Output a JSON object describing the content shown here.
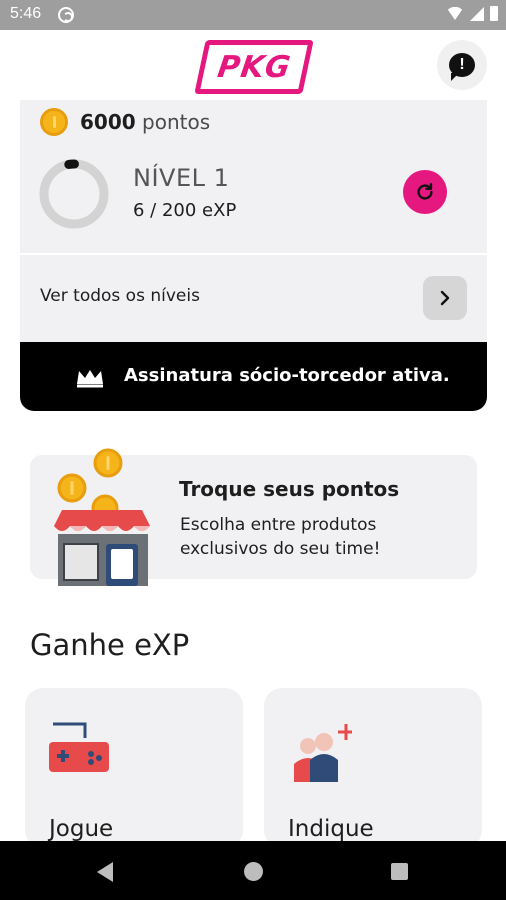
{
  "status_bar": {
    "time": "5:46"
  },
  "header": {
    "logo_text": "PKG",
    "notification_icon": "alert-chat-icon"
  },
  "points": {
    "value": "6000",
    "unit": "pontos"
  },
  "level": {
    "title": "NÍVEL 1",
    "xp_text": "6 / 200 eXP",
    "progress_fraction": 0.03
  },
  "levels_link": {
    "label": "Ver todos os níveis"
  },
  "subscription": {
    "label": "Assinatura sócio-torcedor ativa."
  },
  "trade": {
    "title": "Troque seus pontos",
    "description": "Escolha entre produtos exclusivos do seu time!"
  },
  "earn": {
    "title": "Ganhe eXP",
    "cards": [
      {
        "label": "Jogue",
        "icon": "gamepad-icon"
      },
      {
        "label": "Indique",
        "icon": "refer-friend-icon"
      }
    ]
  },
  "colors": {
    "brand": "#e4187e",
    "card_bg": "#f1f1f3",
    "coin": "#f5b51a"
  }
}
